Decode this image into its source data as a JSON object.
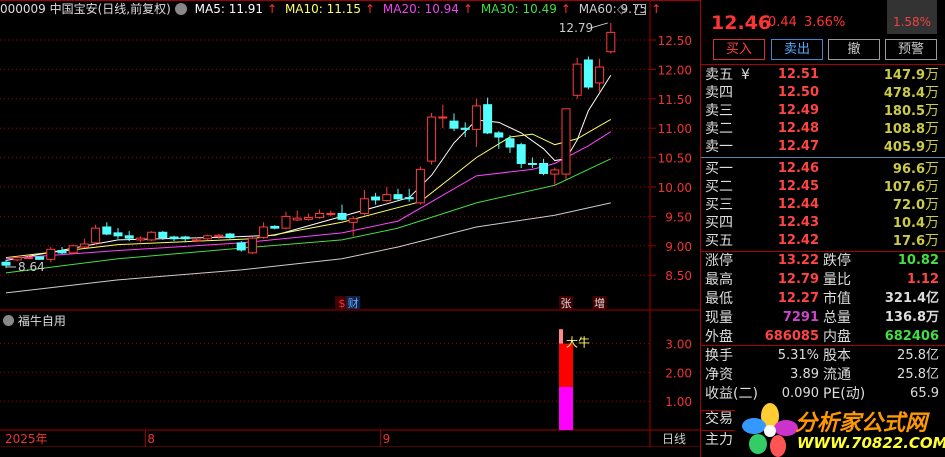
{
  "header": {
    "code_name": "000009 中国宝安(日线,前复权)",
    "ma5": "MA5: 11.91",
    "ma10": "MA10: 11.15",
    "ma20": "MA20: 10.94",
    "ma30": "MA30: 10.49",
    "ma60": "MA60: 9.75",
    "up_arrow": "↑"
  },
  "colors": {
    "up": "#ff3b3b",
    "down": "#54ffff",
    "ma5": "#ffffff",
    "ma10": "#ffff66",
    "ma20": "#ff44ff",
    "ma30": "#44dd44",
    "ma60": "#cccccc",
    "grid": "#a00000"
  },
  "chart_data": {
    "type": "candlestick",
    "ylim": [
      8.2,
      12.9
    ],
    "yticks": [
      "12.50",
      "12.00",
      "11.50",
      "11.00",
      "10.50",
      "10.00",
      "9.50",
      "9.00",
      "8.50"
    ],
    "high_label": "12.79",
    "low_label": "8.64",
    "candles": [
      [
        8.72,
        8.67,
        8.76,
        8.62
      ],
      [
        8.76,
        8.8,
        8.82,
        8.74
      ],
      [
        8.8,
        8.8,
        8.83,
        8.78
      ],
      [
        8.81,
        8.77,
        8.82,
        8.76
      ],
      [
        8.77,
        8.94,
        8.98,
        8.72
      ],
      [
        8.92,
        8.88,
        8.98,
        8.86
      ],
      [
        8.88,
        9.0,
        9.02,
        8.86
      ],
      [
        8.98,
        9.03,
        9.12,
        8.96
      ],
      [
        9.05,
        9.3,
        9.36,
        9.02
      ],
      [
        9.32,
        9.2,
        9.4,
        9.18
      ],
      [
        9.22,
        9.17,
        9.3,
        9.12
      ],
      [
        9.17,
        9.13,
        9.25,
        9.08
      ],
      [
        9.1,
        9.13,
        9.16,
        9.06
      ],
      [
        9.1,
        9.23,
        9.25,
        9.08
      ],
      [
        9.23,
        9.14,
        9.25,
        9.1
      ],
      [
        9.15,
        9.12,
        9.17,
        9.08
      ],
      [
        9.15,
        9.12,
        9.17,
        9.06
      ],
      [
        9.1,
        9.1,
        9.14,
        9.06
      ],
      [
        9.12,
        9.17,
        9.19,
        9.1
      ],
      [
        9.16,
        9.18,
        9.2,
        9.12
      ],
      [
        9.2,
        9.14,
        9.22,
        9.12
      ],
      [
        9.05,
        8.93,
        9.08,
        8.9
      ],
      [
        8.88,
        9.13,
        9.15,
        8.86
      ],
      [
        9.14,
        9.32,
        9.4,
        9.12
      ],
      [
        9.33,
        9.3,
        9.35,
        9.28
      ],
      [
        9.3,
        9.5,
        9.58,
        9.28
      ],
      [
        9.44,
        9.47,
        9.6,
        9.42
      ],
      [
        9.45,
        9.48,
        9.55,
        9.43
      ],
      [
        9.48,
        9.55,
        9.62,
        9.46
      ],
      [
        9.55,
        9.55,
        9.6,
        9.5
      ],
      [
        9.55,
        9.45,
        9.7,
        9.43
      ],
      [
        9.4,
        9.46,
        9.5,
        9.16
      ],
      [
        9.55,
        9.8,
        9.95,
        9.52
      ],
      [
        9.83,
        9.78,
        9.9,
        9.7
      ],
      [
        9.77,
        9.87,
        10.0,
        9.75
      ],
      [
        9.87,
        9.8,
        9.97,
        9.78
      ],
      [
        9.82,
        9.8,
        9.97,
        9.75
      ],
      [
        9.73,
        10.3,
        10.35,
        9.7
      ],
      [
        10.44,
        11.19,
        11.26,
        10.38
      ],
      [
        11.18,
        11.19,
        11.4,
        11.0
      ],
      [
        11.12,
        11.0,
        11.25,
        10.95
      ],
      [
        11.0,
        10.98,
        11.1,
        10.85
      ],
      [
        10.98,
        11.38,
        11.5,
        10.68
      ],
      [
        11.4,
        10.92,
        11.52,
        10.9
      ],
      [
        10.92,
        10.85,
        10.95,
        10.65
      ],
      [
        10.82,
        10.68,
        10.88,
        10.58
      ],
      [
        10.72,
        10.4,
        10.75,
        10.32
      ],
      [
        10.4,
        10.39,
        10.5,
        10.32
      ],
      [
        10.4,
        10.23,
        10.48,
        10.2
      ],
      [
        10.22,
        10.29,
        10.33,
        10.02
      ],
      [
        10.22,
        11.33,
        11.33,
        10.13
      ],
      [
        11.56,
        12.09,
        12.2,
        11.5
      ],
      [
        12.16,
        11.7,
        12.22,
        11.66
      ],
      [
        11.77,
        12.04,
        12.18,
        11.62
      ],
      [
        12.3,
        12.63,
        12.79,
        12.27
      ]
    ],
    "ma": {
      "ma5": [
        [
          0,
          8.75
        ],
        [
          10,
          9.1
        ],
        [
          20,
          9.15
        ],
        [
          24,
          9.18
        ],
        [
          30,
          9.5
        ],
        [
          36,
          9.82
        ],
        [
          38,
          10.2
        ],
        [
          40,
          10.75
        ],
        [
          42,
          11.14
        ],
        [
          44,
          11.1
        ],
        [
          46,
          10.92
        ],
        [
          48,
          10.65
        ],
        [
          49,
          10.45
        ],
        [
          50,
          10.48
        ],
        [
          51,
          10.8
        ],
        [
          52,
          11.3
        ],
        [
          54,
          11.9
        ]
      ],
      "ma10": [
        [
          0,
          8.8
        ],
        [
          10,
          9.02
        ],
        [
          22,
          9.12
        ],
        [
          30,
          9.4
        ],
        [
          37,
          9.75
        ],
        [
          40,
          10.2
        ],
        [
          42,
          10.5
        ],
        [
          45,
          10.85
        ],
        [
          47,
          10.9
        ],
        [
          49,
          10.72
        ],
        [
          51,
          10.82
        ],
        [
          54,
          11.15
        ]
      ],
      "ma20": [
        [
          0,
          8.78
        ],
        [
          10,
          8.92
        ],
        [
          21,
          9.05
        ],
        [
          30,
          9.22
        ],
        [
          35,
          9.42
        ],
        [
          42,
          10.19
        ],
        [
          47,
          10.3
        ],
        [
          49,
          10.4
        ],
        [
          52,
          10.7
        ],
        [
          54,
          10.94
        ]
      ],
      "ma30": [
        [
          0,
          8.54
        ],
        [
          10,
          8.78
        ],
        [
          21,
          8.96
        ],
        [
          30,
          9.1
        ],
        [
          35,
          9.3
        ],
        [
          42,
          9.73
        ],
        [
          49,
          10.03
        ],
        [
          54,
          10.48
        ]
      ],
      "ma60": [
        [
          0,
          8.2
        ],
        [
          10,
          8.42
        ],
        [
          21,
          8.59
        ],
        [
          30,
          8.78
        ],
        [
          35,
          8.98
        ],
        [
          42,
          9.32
        ],
        [
          49,
          9.52
        ],
        [
          54,
          9.73
        ]
      ]
    },
    "markers": [
      {
        "idx": 30,
        "text": "$"
      },
      {
        "idx": 31,
        "text": "财"
      },
      {
        "idx": 50,
        "text": "张"
      },
      {
        "idx": 53,
        "text": "增"
      }
    ],
    "indicator": {
      "name": "福牛自用",
      "yticks": [
        "3.00",
        "2.00",
        "1.00"
      ],
      "ylim": [
        0,
        4
      ],
      "bar_idx": 50,
      "segments": [
        [
          0,
          1.5,
          "#ff00ff"
        ],
        [
          1.5,
          3.0,
          "#ff0000"
        ],
        [
          3.0,
          3.5,
          "#ff8888"
        ]
      ],
      "label": "大牛"
    },
    "xaxis": {
      "year": "2025年",
      "months": [
        {
          "idx": 12,
          "label": "8"
        },
        {
          "idx": 33,
          "label": "9"
        }
      ],
      "period": "日线"
    }
  },
  "quote": {
    "price": "12.46",
    "change": "0.44",
    "pct": "3.66%",
    "side_pct": "1.58%"
  },
  "buttons": {
    "buy": "买入",
    "sell": "卖出",
    "cancel": "撤",
    "alert": "预警"
  },
  "sell": [
    {
      "label": "卖五",
      "price": "12.51",
      "vol": "147.9",
      "unit": "万",
      "extra": "¥"
    },
    {
      "label": "卖四",
      "price": "12.50",
      "vol": "478.4",
      "unit": "万"
    },
    {
      "label": "卖三",
      "price": "12.49",
      "vol": "180.5",
      "unit": "万"
    },
    {
      "label": "卖二",
      "price": "12.48",
      "vol": "108.8",
      "unit": "万"
    },
    {
      "label": "卖一",
      "price": "12.47",
      "vol": "405.9",
      "unit": "万"
    }
  ],
  "buy": [
    {
      "label": "买一",
      "price": "12.46",
      "vol": "96.6",
      "unit": "万"
    },
    {
      "label": "买二",
      "price": "12.45",
      "vol": "107.6",
      "unit": "万"
    },
    {
      "label": "买三",
      "price": "12.44",
      "vol": "72.0",
      "unit": "万"
    },
    {
      "label": "买四",
      "price": "12.43",
      "vol": "10.4",
      "unit": "万"
    },
    {
      "label": "买五",
      "price": "12.42",
      "vol": "17.6",
      "unit": "万"
    }
  ],
  "stats": [
    {
      "l": "涨停",
      "v": "13.22",
      "c": "#f44",
      "l2": "跌停",
      "v2": "10.82",
      "c2": "#4d4"
    },
    {
      "l": "最高",
      "v": "12.79",
      "c": "#f44",
      "l2": "量比",
      "v2": "1.12",
      "c2": "#f44"
    },
    {
      "l": "最低",
      "v": "12.27",
      "c": "#f44",
      "l2": "市值",
      "v2": "321.4亿",
      "c2": "#ddd"
    },
    {
      "l": "现量",
      "v": "7291",
      "c": "#c4c",
      "l2": "总量",
      "v2": "136.8万",
      "c2": "#ddd"
    },
    {
      "l": "外盘",
      "v": "686085",
      "c": "#f44",
      "l2": "内盘",
      "v2": "682406",
      "c2": "#4d4"
    }
  ],
  "stats2": [
    {
      "l": "换手",
      "v": "5.31%",
      "l2": "股本",
      "v2": "25.8亿"
    },
    {
      "l": "净资",
      "v": "3.89",
      "l2": "流通",
      "v2": "25.8亿"
    },
    {
      "l": "收益(二)",
      "v": "0.090",
      "l2": "PE(动)",
      "v2": "65.9"
    }
  ],
  "bottom": {
    "trade": "交易",
    "main": "主力"
  },
  "watermark": {
    "title": "分析家公式网",
    "url": "WWW.70822.COM"
  }
}
